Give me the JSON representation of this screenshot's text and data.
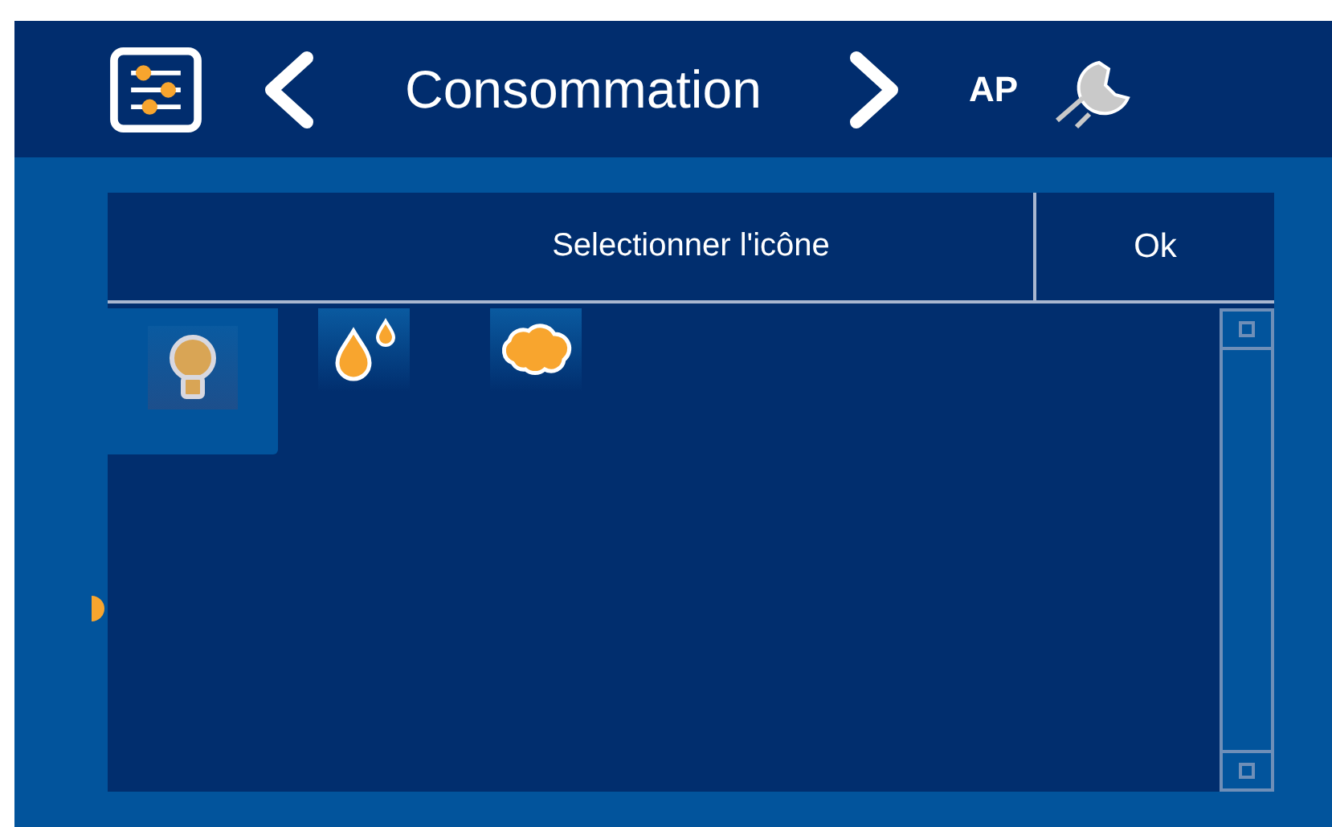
{
  "header": {
    "title": "Consommation",
    "user": "AP"
  },
  "dialog": {
    "title": "Selectionner l'icône",
    "ok": "Ok"
  },
  "icons": [
    {
      "kind": "bulb",
      "selected": true
    },
    {
      "kind": "drops",
      "selected": false
    },
    {
      "kind": "cloud",
      "selected": false
    }
  ]
}
